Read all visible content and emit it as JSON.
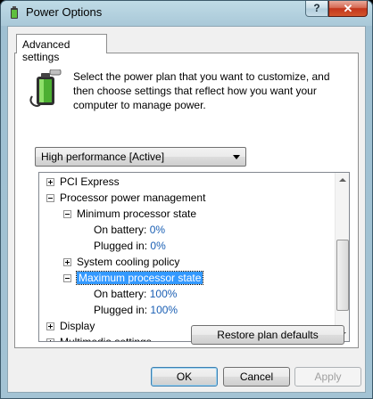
{
  "window": {
    "title": "Power Options",
    "help_label": "?",
    "close_label": "✕"
  },
  "tab": {
    "label": "Advanced settings"
  },
  "description": "Select the power plan that you want to customize, and then choose settings that reflect how you want your computer to manage power.",
  "plan_select": {
    "value": "High performance [Active]"
  },
  "tree": {
    "pci_express": "PCI Express",
    "processor_power": "Processor power management",
    "min_state": "Minimum processor state",
    "min_on_battery_label": "On battery:",
    "min_on_battery_value": "0%",
    "min_plugged_label": "Plugged in:",
    "min_plugged_value": "0%",
    "cooling_policy": "System cooling policy",
    "max_state": "Maximum processor state",
    "max_on_battery_label": "On battery:",
    "max_on_battery_value": "100%",
    "max_plugged_label": "Plugged in:",
    "max_plugged_value": "100%",
    "display": "Display",
    "multimedia": "Multimedia settings"
  },
  "buttons": {
    "restore": "Restore plan defaults",
    "ok": "OK",
    "cancel": "Cancel",
    "apply": "Apply"
  },
  "icons": {
    "app": "power-options-icon",
    "battery": "battery-plug-icon",
    "help": "help-icon",
    "close": "close-icon",
    "dropdown": "chevron-down-icon"
  }
}
